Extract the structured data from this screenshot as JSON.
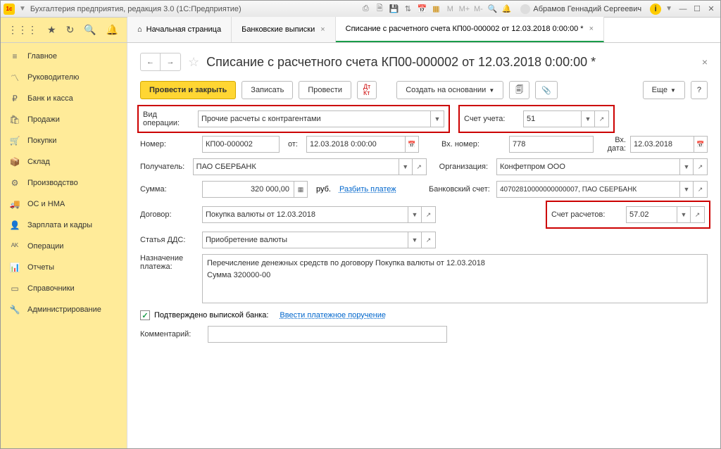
{
  "titlebar": {
    "title": "Бухгалтерия предприятия, редакция 3.0  (1С:Предприятие)",
    "user": "Абрамов Геннадий Сергеевич"
  },
  "tabs": [
    {
      "label": "Начальная страница"
    },
    {
      "label": "Банковские выписки"
    },
    {
      "label": "Списание с расчетного счета КП00-000002 от 12.03.2018 0:00:00 *"
    }
  ],
  "sidebar": [
    "Главное",
    "Руководителю",
    "Банк и касса",
    "Продажи",
    "Покупки",
    "Склад",
    "Производство",
    "ОС и НМА",
    "Зарплата и кадры",
    "Операции",
    "Отчеты",
    "Справочники",
    "Администрирование"
  ],
  "page": {
    "title": "Списание с расчетного счета КП00-000002 от 12.03.2018 0:00:00 *"
  },
  "cmd": {
    "postClose": "Провести и закрыть",
    "save": "Записать",
    "post": "Провести",
    "createBased": "Создать на основании",
    "more": "Еще"
  },
  "form": {
    "opType": {
      "label": "Вид операции:",
      "value": "Прочие расчеты с контрагентами"
    },
    "account": {
      "label": "Счет учета:",
      "value": "51"
    },
    "number": {
      "label": "Номер:",
      "value": "КП00-000002"
    },
    "date": {
      "label": "от:",
      "value": "12.03.2018  0:00:00"
    },
    "inNumber": {
      "label": "Вх. номер:",
      "value": "778"
    },
    "inDate": {
      "label": "Вх. дата:",
      "value": "12.03.2018"
    },
    "recipient": {
      "label": "Получатель:",
      "value": "ПАО СБЕРБАНК"
    },
    "org": {
      "label": "Организация:",
      "value": "Конфетпром ООО"
    },
    "sum": {
      "label": "Сумма:",
      "value": "320 000,00",
      "currency": "руб."
    },
    "splitLink": "Разбить платеж",
    "bankAcc": {
      "label": "Банковский счет:",
      "value": "40702810000000000007, ПАО СБЕРБАНК"
    },
    "contract": {
      "label": "Договор:",
      "value": "Покупка валюты от 12.03.2018"
    },
    "settleAcc": {
      "label": "Счет расчетов:",
      "value": "57.02"
    },
    "dds": {
      "label": "Статья ДДС:",
      "value": "Приобретение валюты"
    },
    "purpose": {
      "label": "Назначение платежа:",
      "line1": "Перечисление денежных средств по договору Покупка валюты от 12.03.2018",
      "line2": "Сумма 320000-00"
    },
    "confirmed": {
      "label": "Подтверждено выпиской банка:"
    },
    "paymentOrderLink": "Ввести платежное поручение",
    "comment": {
      "label": "Комментарий:",
      "value": ""
    }
  }
}
